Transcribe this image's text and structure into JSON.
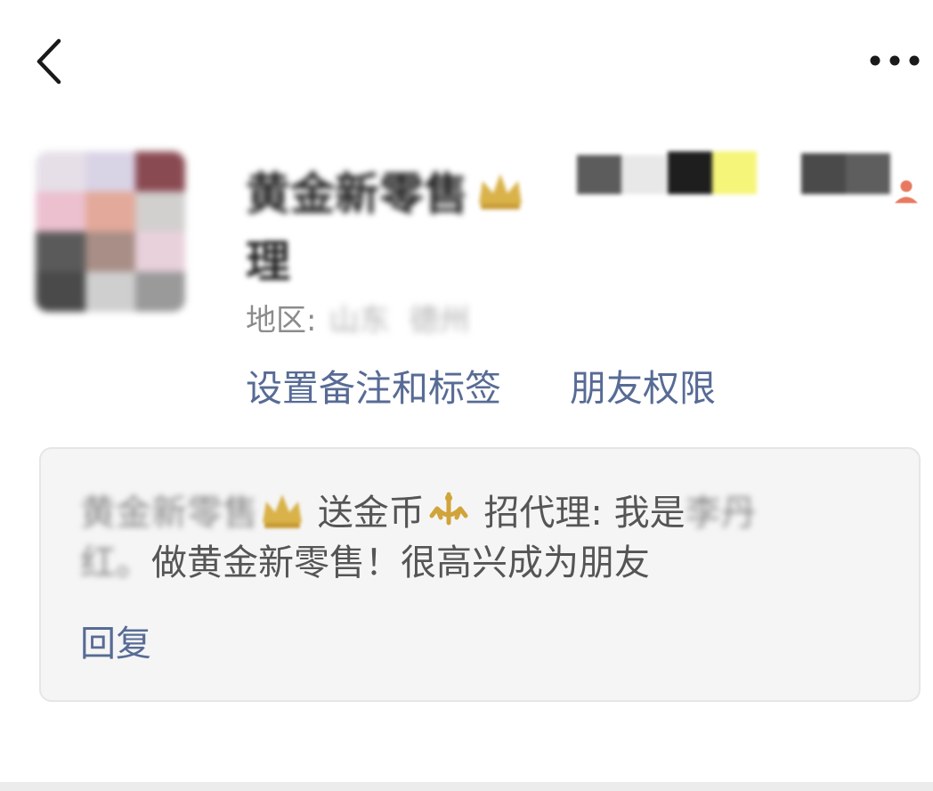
{
  "nav": {
    "back_icon": "chevron-left-icon",
    "more_icon": "more-dots-icon"
  },
  "profile": {
    "avatar_icon": "avatar",
    "name_line1": "黄金新零售",
    "name_badge_icon": "crown-icon",
    "name_line2": "理",
    "contact_icon": "contact-person-icon",
    "region_label": "地区:",
    "region_province": "山东",
    "region_city": "德州"
  },
  "actions": {
    "remark_label": "设置备注和标签",
    "permission_label": "朋友权限"
  },
  "message": {
    "sender_prefix": "黄金新零售",
    "text_part1": "送金币",
    "text_part2": "招代理: 我是",
    "sender_name_tail": "李丹",
    "sender_name_end": "红。",
    "text_part3": "做黄金新零售！很高兴成为朋友",
    "reply_label": "回复"
  },
  "colors": {
    "link": "#576b95",
    "card_bg": "#f5f5f5",
    "crown_gold": "#d9b24a"
  }
}
